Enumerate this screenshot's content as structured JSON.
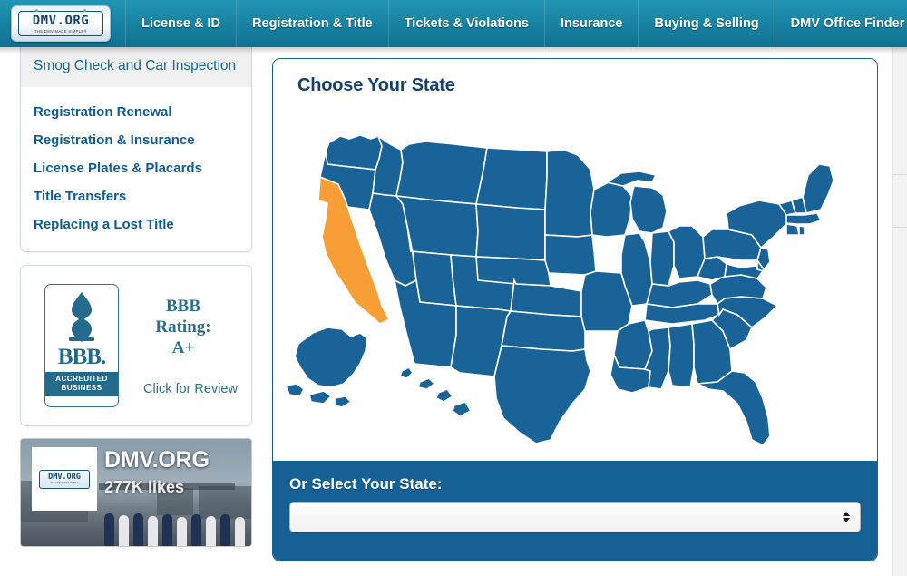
{
  "nav": {
    "logo": {
      "main_text": "DMV.ORG",
      "tagline": "THE DMV MADE SIMPLE®"
    },
    "items": [
      {
        "label": "License & ID"
      },
      {
        "label": "Registration & Title"
      },
      {
        "label": "Tickets & Violations"
      },
      {
        "label": "Insurance"
      },
      {
        "label": "Buying & Selling"
      },
      {
        "label": "DMV Office Finder"
      }
    ]
  },
  "sidebar": {
    "active_item": {
      "label": "Smog Check and Car Inspection"
    },
    "links": [
      {
        "label": "Registration Renewal"
      },
      {
        "label": "Registration & Insurance"
      },
      {
        "label": "License Plates & Placards"
      },
      {
        "label": "Title Transfers"
      },
      {
        "label": "Replacing a Lost Title"
      }
    ],
    "bbb": {
      "word": "BBB.",
      "accredited_line1": "ACCREDITED",
      "accredited_line2": "BUSINESS",
      "rating_line1": "BBB",
      "rating_line2": "Rating:",
      "rating_line3": "A+",
      "review_link": "Click for Review"
    },
    "facebook": {
      "page_title": "DMV.ORG",
      "likes": "277K likes",
      "thumb_main": "DMV.ORG",
      "thumb_sub": "THE DMV MADE SIMPLE"
    }
  },
  "main": {
    "title": "Choose Your State",
    "select_label": "Or Select Your State:",
    "select_value": "",
    "selected_state": "California",
    "selected_state_color": "#f79f36",
    "default_state_color": "#1a6399",
    "state_border_color": "#ffffff"
  },
  "colors": {
    "nav_background": "#1a86a6",
    "panel_border": "#1a6399",
    "panel_blue": "#156195",
    "link_blue": "#0f5c96",
    "title_navy": "#17406e",
    "bbb_teal": "#236a8c"
  }
}
